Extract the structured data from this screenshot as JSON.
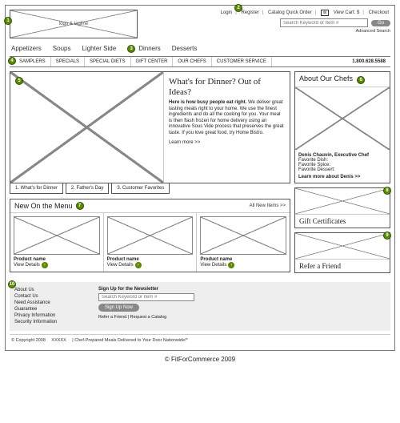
{
  "header": {
    "logo_label": "logo & tagline",
    "util": {
      "login": "Login",
      "register": "Register",
      "quick_order": "Catalog Quick Order",
      "cart_icon": "⊠",
      "view_cart": "View Cart: $",
      "checkout": "Checkout"
    },
    "search_placeholder": "Search Keyword or Item #",
    "go_label": "Go",
    "advanced": "Advanced Search"
  },
  "mainnav": [
    "Appetizers",
    "Soups",
    "Lighter Side",
    "Dinners",
    "Desserts"
  ],
  "subnav": {
    "items": [
      "SAMPLERS",
      "SPECIALS",
      "SPECIAL DIETS",
      "GIFT CENTER",
      "OUR CHEFS",
      "CUSTOMER SERVICE"
    ],
    "phone": "1.800.628.5588"
  },
  "hero": {
    "title": "What's for Dinner? Out of Ideas?",
    "lead": "Here is how busy people eat right.",
    "body": "We deliver great tasting meals right to your home. We use the finest ingredients and do all the cooking for you. Your meal is then flash frozen for home delivery using an innovative Sous Vide process that preserves the great taste. If you love great food, try Home Bistro.",
    "learn": "Learn more >>"
  },
  "tabs": [
    "1. What's for Dinner",
    "2. Father's Day",
    "3. Customer Favorites"
  ],
  "new_menu": {
    "title": "New On the Menu",
    "all_link": "All New Items >>",
    "products": [
      {
        "name": "Product name",
        "link": "View Details"
      },
      {
        "name": "Product name",
        "link": "View Details"
      },
      {
        "name": "Product name",
        "link": "View Details"
      }
    ]
  },
  "side": {
    "chefs_title": "About Our Chefs",
    "chef_name": "Denis Chauvin, Executive Chef",
    "chef_lines": [
      "Favorite Dish:",
      "Favorite Spice:",
      "Favorite Dessert:"
    ],
    "chef_more": "Learn more about Denis >>",
    "gift_title": "Gift Certificates",
    "refer_title": "Refer a Friend"
  },
  "footer": {
    "links": [
      "About Us",
      "Contact Us",
      "Need Assistance",
      "Guarantee",
      "Privacy Information",
      "Security Information"
    ],
    "newsletter_title": "Sign Up for the Newsletter",
    "newsletter_placeholder": "Search Keyword or Item #",
    "signup": "Sign Up Now",
    "sublinks": "Refer a Friend   |   Request a Catalog",
    "copyright": "© Copyright 2008",
    "rating": "XXXXX",
    "tagline": "|   Chef-Prepared Meals Delivered to Your Door Nationwide!*"
  },
  "credit": "© FitForCommerce 2009",
  "badges": [
    "1",
    "2",
    "3",
    "4",
    "5",
    "6",
    "7",
    "8",
    "9",
    "10"
  ]
}
